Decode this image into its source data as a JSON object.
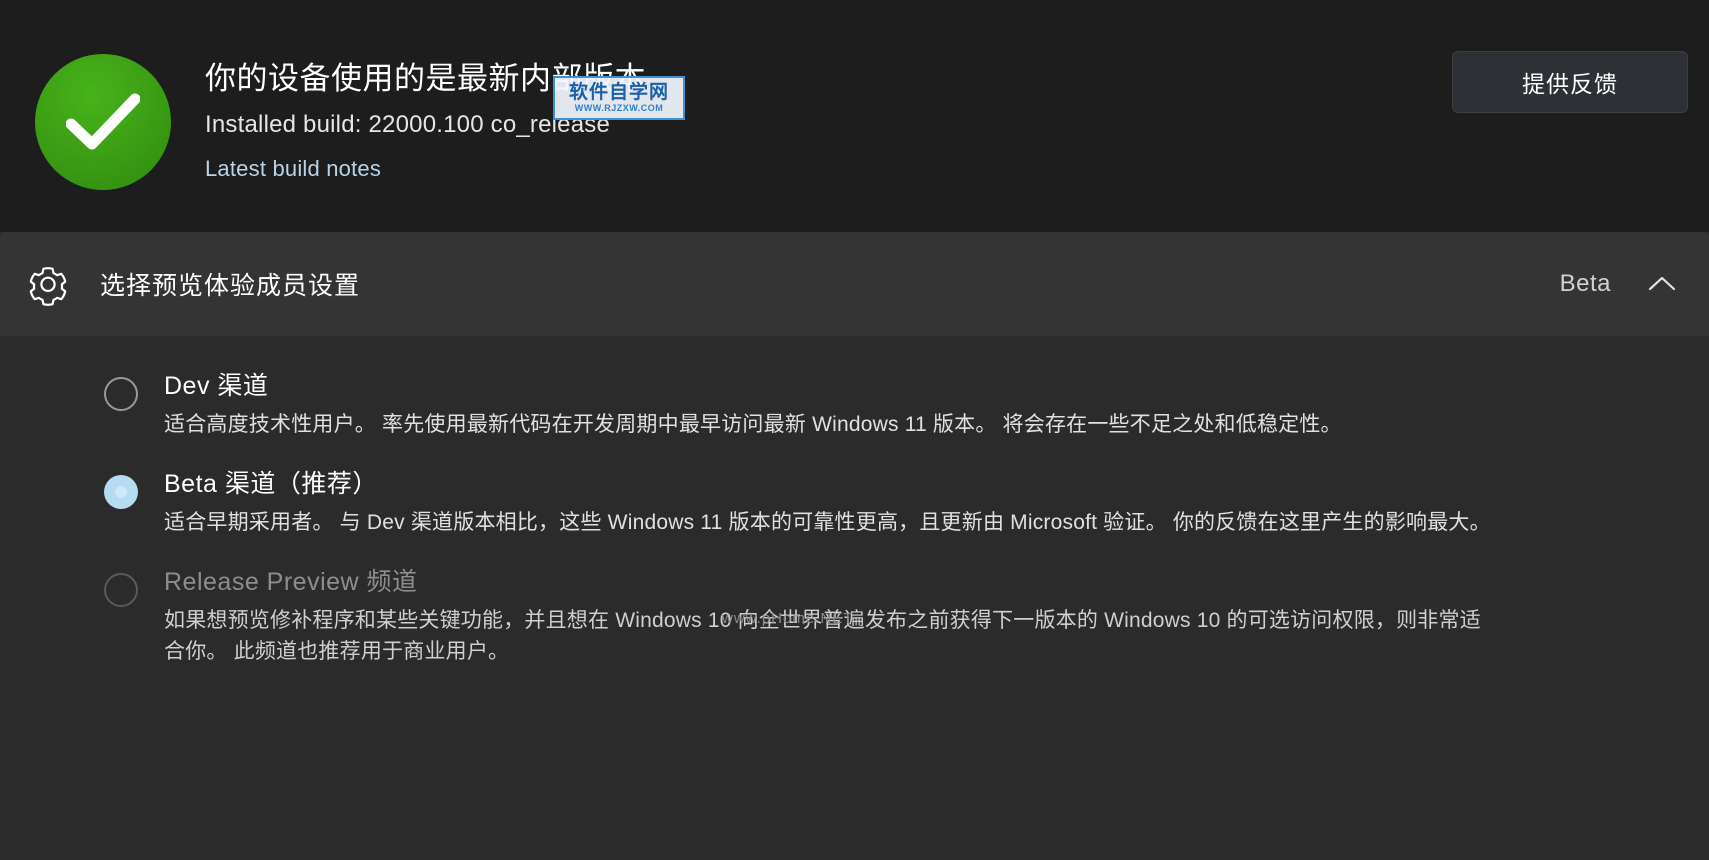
{
  "status": {
    "icon": "green-check-circle",
    "title": "你的设备使用的是最新内部版本",
    "build": "Installed build: 22000.100 co_release",
    "link": "Latest build notes",
    "feedback_button": "提供反馈",
    "accent_green": "#3da015"
  },
  "expander": {
    "icon": "gear-icon",
    "title": "选择预览体验成员设置",
    "value": "Beta",
    "chevron": "chevron-up-icon",
    "expanded": true
  },
  "channels": [
    {
      "id": "dev",
      "title": "Dev 渠道",
      "description": "适合高度技术性用户。 率先使用最新代码在开发周期中最早访问最新 Windows 11 版本。 将会存在一些不足之处和低稳定性。",
      "selected": false,
      "disabled": false
    },
    {
      "id": "beta",
      "title": "Beta 渠道（推荐）",
      "description": "适合早期采用者。 与 Dev 渠道版本相比，这些 Windows 11 版本的可靠性更高，且更新由 Microsoft 验证。 你的反馈在这里产生的影响最大。",
      "selected": true,
      "disabled": false
    },
    {
      "id": "release-preview",
      "title": "Release Preview 频道",
      "description": "如果想预览修补程序和某些关键功能，并且想在 Windows 10 向全世界普遍发布之前获得下一版本的 Windows 10 的可选访问权限，则非常适合你。 此频道也推荐用于商业用户。",
      "selected": false,
      "disabled": true
    }
  ],
  "watermarks": {
    "rjzxw_line1": "软件自学网",
    "rjzxw_line2": "WWW.RJZXW.COM",
    "phome": "www.pHome.NET"
  }
}
